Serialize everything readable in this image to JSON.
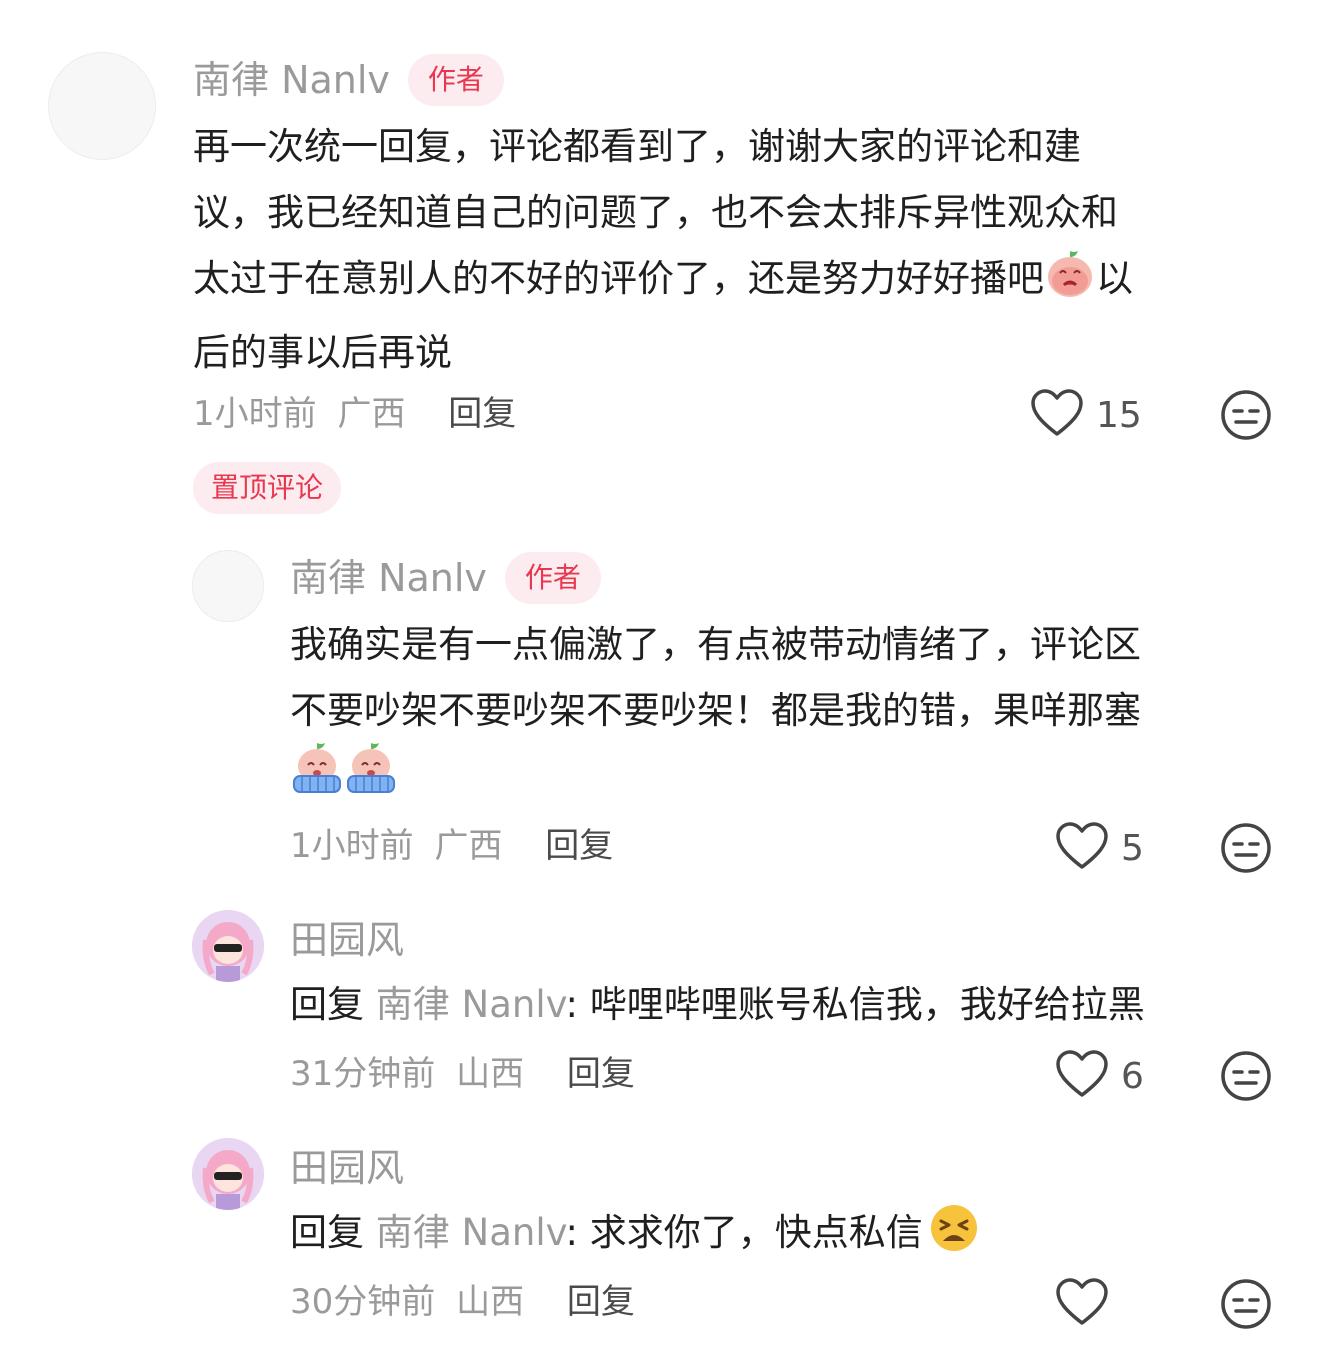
{
  "comments": [
    {
      "username": "南律 Nanlv",
      "badge": "作者",
      "lines": [
        "再一次统一回复，评论都看到了，谢谢大家的评论和建",
        "议，我已经知道自己的问题了，也不会太排斥异性观众和",
        "太过于在意别人的不好的评价了，还是努力好好播吧",
        "以",
        "后的事以后再说"
      ],
      "time": "1小时前",
      "location": "广西",
      "reply_label": "回复",
      "likes": "15",
      "pinned_label": "置顶评论"
    },
    {
      "username": "南律 Nanlv",
      "badge": "作者",
      "lines": [
        "我确实是有一点偏激了，有点被带动情绪了，评论区",
        "不要吵架不要吵架不要吵架！都是我的错，果咩那塞"
      ],
      "time": "1小时前",
      "location": "广西",
      "reply_label": "回复",
      "likes": "5"
    },
    {
      "username": "田园风",
      "reply_prefix": "回复",
      "reply_target": "南律 Nanlv",
      "text": ": 哔哩哔哩账号私信我，我好给拉黑",
      "time": "31分钟前",
      "location": "山西",
      "reply_label": "回复",
      "likes": "6"
    },
    {
      "username": "田园风",
      "reply_prefix": "回复",
      "reply_target": "南律 Nanlv",
      "text": ": 求求你了，快点私信",
      "time": "30分钟前",
      "location": "山西",
      "reply_label": "回复",
      "likes": ""
    }
  ],
  "icons": {
    "like": "heart-outline-icon",
    "dislike": "meh-face-icon",
    "sticker_peach": "peach-sticker-icon",
    "emoji_tired": "tired-face-emoji"
  },
  "colors": {
    "accent_red": "#e8374f",
    "tag_bg": "#fdecef",
    "muted_text": "#9a9a9a"
  }
}
